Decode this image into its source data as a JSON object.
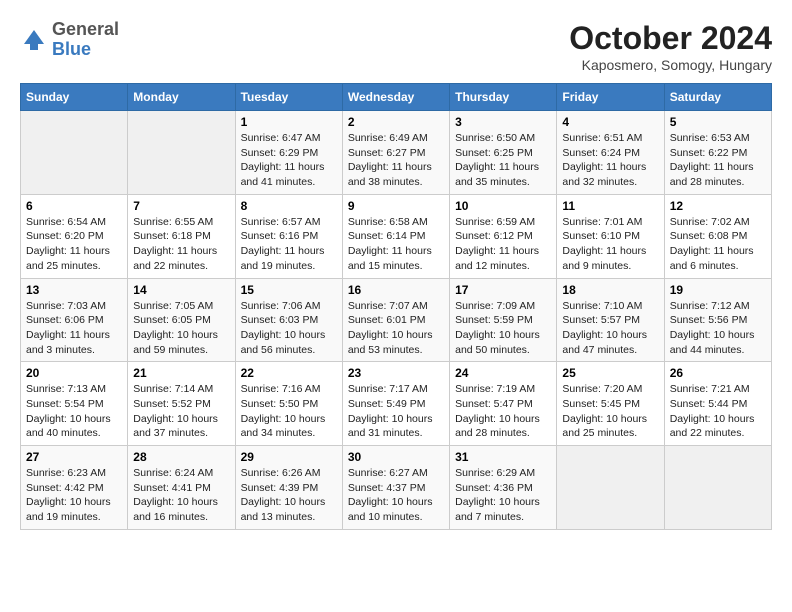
{
  "header": {
    "logo": {
      "line1": "General",
      "line2": "Blue"
    },
    "title": "October 2024",
    "subtitle": "Kaposmero, Somogy, Hungary"
  },
  "weekdays": [
    "Sunday",
    "Monday",
    "Tuesday",
    "Wednesday",
    "Thursday",
    "Friday",
    "Saturday"
  ],
  "weeks": [
    [
      {
        "num": "",
        "empty": true
      },
      {
        "num": "",
        "empty": true
      },
      {
        "num": "1",
        "sunrise": "6:47 AM",
        "sunset": "6:29 PM",
        "daylight": "11 hours and 41 minutes."
      },
      {
        "num": "2",
        "sunrise": "6:49 AM",
        "sunset": "6:27 PM",
        "daylight": "11 hours and 38 minutes."
      },
      {
        "num": "3",
        "sunrise": "6:50 AM",
        "sunset": "6:25 PM",
        "daylight": "11 hours and 35 minutes."
      },
      {
        "num": "4",
        "sunrise": "6:51 AM",
        "sunset": "6:24 PM",
        "daylight": "11 hours and 32 minutes."
      },
      {
        "num": "5",
        "sunrise": "6:53 AM",
        "sunset": "6:22 PM",
        "daylight": "11 hours and 28 minutes."
      }
    ],
    [
      {
        "num": "6",
        "sunrise": "6:54 AM",
        "sunset": "6:20 PM",
        "daylight": "11 hours and 25 minutes."
      },
      {
        "num": "7",
        "sunrise": "6:55 AM",
        "sunset": "6:18 PM",
        "daylight": "11 hours and 22 minutes."
      },
      {
        "num": "8",
        "sunrise": "6:57 AM",
        "sunset": "6:16 PM",
        "daylight": "11 hours and 19 minutes."
      },
      {
        "num": "9",
        "sunrise": "6:58 AM",
        "sunset": "6:14 PM",
        "daylight": "11 hours and 15 minutes."
      },
      {
        "num": "10",
        "sunrise": "6:59 AM",
        "sunset": "6:12 PM",
        "daylight": "11 hours and 12 minutes."
      },
      {
        "num": "11",
        "sunrise": "7:01 AM",
        "sunset": "6:10 PM",
        "daylight": "11 hours and 9 minutes."
      },
      {
        "num": "12",
        "sunrise": "7:02 AM",
        "sunset": "6:08 PM",
        "daylight": "11 hours and 6 minutes."
      }
    ],
    [
      {
        "num": "13",
        "sunrise": "7:03 AM",
        "sunset": "6:06 PM",
        "daylight": "11 hours and 3 minutes."
      },
      {
        "num": "14",
        "sunrise": "7:05 AM",
        "sunset": "6:05 PM",
        "daylight": "10 hours and 59 minutes."
      },
      {
        "num": "15",
        "sunrise": "7:06 AM",
        "sunset": "6:03 PM",
        "daylight": "10 hours and 56 minutes."
      },
      {
        "num": "16",
        "sunrise": "7:07 AM",
        "sunset": "6:01 PM",
        "daylight": "10 hours and 53 minutes."
      },
      {
        "num": "17",
        "sunrise": "7:09 AM",
        "sunset": "5:59 PM",
        "daylight": "10 hours and 50 minutes."
      },
      {
        "num": "18",
        "sunrise": "7:10 AM",
        "sunset": "5:57 PM",
        "daylight": "10 hours and 47 minutes."
      },
      {
        "num": "19",
        "sunrise": "7:12 AM",
        "sunset": "5:56 PM",
        "daylight": "10 hours and 44 minutes."
      }
    ],
    [
      {
        "num": "20",
        "sunrise": "7:13 AM",
        "sunset": "5:54 PM",
        "daylight": "10 hours and 40 minutes."
      },
      {
        "num": "21",
        "sunrise": "7:14 AM",
        "sunset": "5:52 PM",
        "daylight": "10 hours and 37 minutes."
      },
      {
        "num": "22",
        "sunrise": "7:16 AM",
        "sunset": "5:50 PM",
        "daylight": "10 hours and 34 minutes."
      },
      {
        "num": "23",
        "sunrise": "7:17 AM",
        "sunset": "5:49 PM",
        "daylight": "10 hours and 31 minutes."
      },
      {
        "num": "24",
        "sunrise": "7:19 AM",
        "sunset": "5:47 PM",
        "daylight": "10 hours and 28 minutes."
      },
      {
        "num": "25",
        "sunrise": "7:20 AM",
        "sunset": "5:45 PM",
        "daylight": "10 hours and 25 minutes."
      },
      {
        "num": "26",
        "sunrise": "7:21 AM",
        "sunset": "5:44 PM",
        "daylight": "10 hours and 22 minutes."
      }
    ],
    [
      {
        "num": "27",
        "sunrise": "6:23 AM",
        "sunset": "4:42 PM",
        "daylight": "10 hours and 19 minutes."
      },
      {
        "num": "28",
        "sunrise": "6:24 AM",
        "sunset": "4:41 PM",
        "daylight": "10 hours and 16 minutes."
      },
      {
        "num": "29",
        "sunrise": "6:26 AM",
        "sunset": "4:39 PM",
        "daylight": "10 hours and 13 minutes."
      },
      {
        "num": "30",
        "sunrise": "6:27 AM",
        "sunset": "4:37 PM",
        "daylight": "10 hours and 10 minutes."
      },
      {
        "num": "31",
        "sunrise": "6:29 AM",
        "sunset": "4:36 PM",
        "daylight": "10 hours and 7 minutes."
      },
      {
        "num": "",
        "empty": true
      },
      {
        "num": "",
        "empty": true
      }
    ]
  ]
}
